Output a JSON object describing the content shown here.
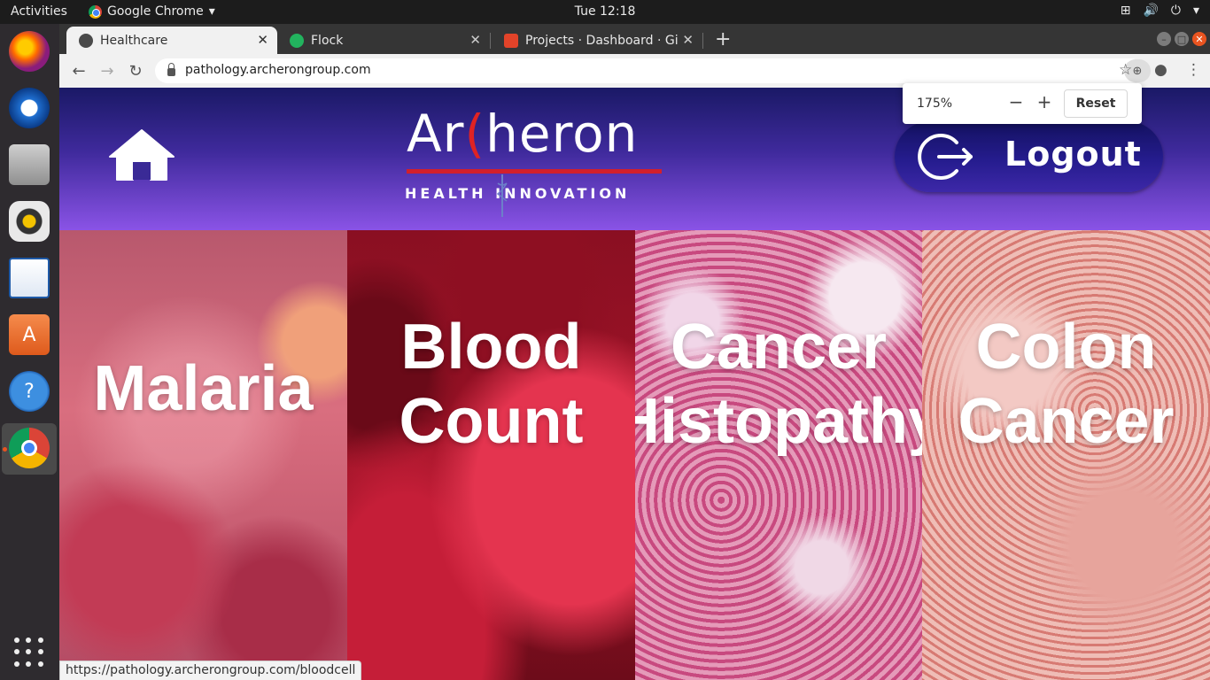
{
  "system": {
    "activities": "Activities",
    "app_name": "Google Chrome",
    "clock": "Tue 12:18"
  },
  "dock": {
    "items": [
      "firefox-icon",
      "thunderbird-icon",
      "files-icon",
      "rhythmbox-icon",
      "libreoffice-writer-icon",
      "software-center-icon",
      "help-icon",
      "chrome-icon",
      "show-apps-icon"
    ]
  },
  "browser": {
    "tabs": [
      {
        "label": "Healthcare",
        "active": true
      },
      {
        "label": "Flock",
        "active": false
      },
      {
        "label": "Projects · Dashboard · Git",
        "active": false
      }
    ],
    "url": "pathology.archerongroup.com",
    "zoom": {
      "level": "175%",
      "minus": "−",
      "plus": "+",
      "reset": "Reset"
    },
    "status_url": "https://pathology.archerongroup.com/bloodcell"
  },
  "site": {
    "logo": {
      "brand_left": "Ar",
      "brand_c": "(",
      "brand_right": "heron",
      "tagline": "HEALTH INNOVATION"
    },
    "logout_label": "Logout",
    "panels": [
      {
        "lines": [
          "Malaria"
        ]
      },
      {
        "lines": [
          "Blood",
          "Count"
        ]
      },
      {
        "lines": [
          "Cancer",
          "Histopathy"
        ]
      },
      {
        "lines": [
          "Colon",
          "Cancer"
        ]
      }
    ]
  },
  "colors": {
    "header_top": "#1a1966",
    "header_bottom": "#8a53e6",
    "logo_red": "#d21f2b",
    "ubuntu_orange": "#e95420"
  }
}
